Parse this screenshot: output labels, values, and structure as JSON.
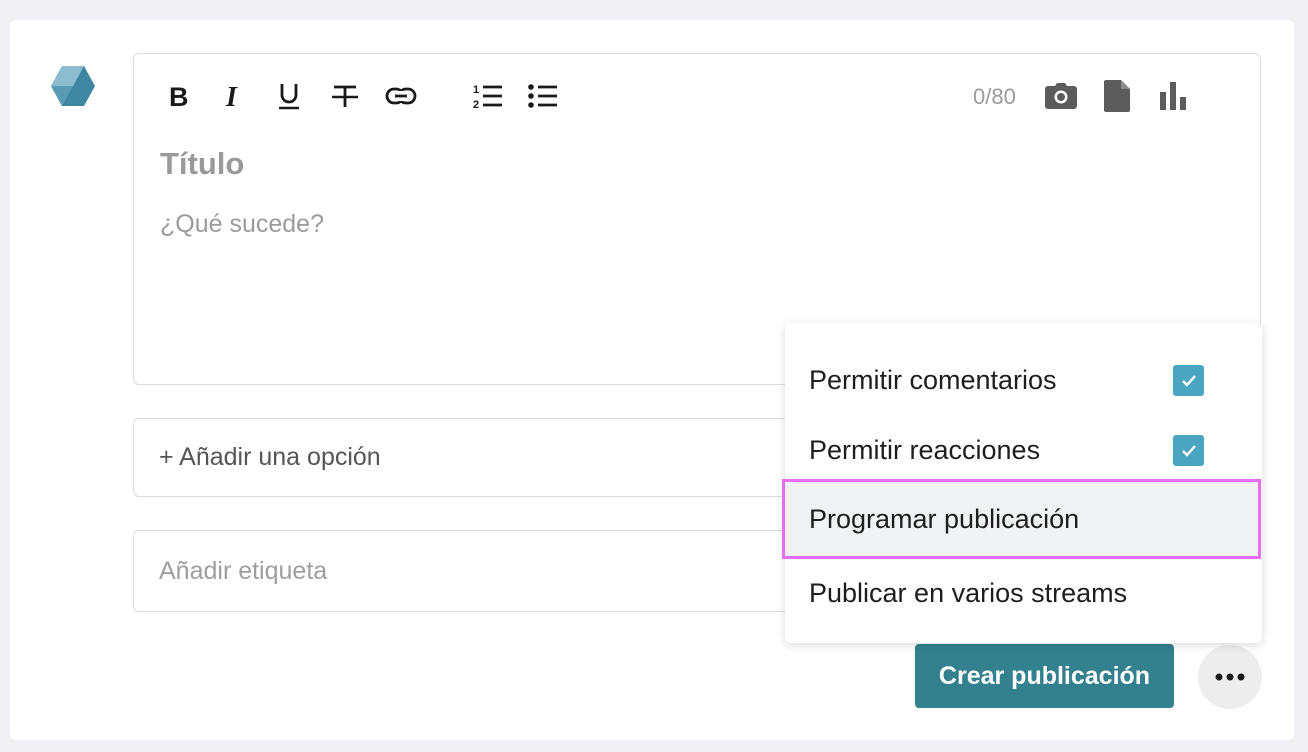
{
  "toolbar": {
    "counter": "0/80",
    "icons": [
      "bold-icon",
      "italic-icon",
      "underline-icon",
      "strikethrough-icon",
      "link-icon",
      "ordered-list-icon",
      "bullet-list-icon",
      "camera-icon",
      "file-icon",
      "bar-chart-icon"
    ]
  },
  "editor": {
    "title_placeholder": "Título",
    "body_placeholder": "¿Qué sucede?"
  },
  "poll": {
    "add_option_label": "+ Añadir una opción"
  },
  "tags": {
    "placeholder": "Añadir etiqueta"
  },
  "actions": {
    "create_label": "Crear publicación",
    "more_icon": "more-horizontal-icon"
  },
  "menu": {
    "items": [
      {
        "label": "Permitir comentarios",
        "checked": true
      },
      {
        "label": "Permitir reacciones",
        "checked": true
      },
      {
        "label": "Programar publicación",
        "highlighted": true
      },
      {
        "label": "Publicar en varios streams"
      }
    ]
  },
  "colors": {
    "primary": "#33808f",
    "checkbox": "#4aa6c0",
    "highlight_border": "#e86ef0"
  }
}
